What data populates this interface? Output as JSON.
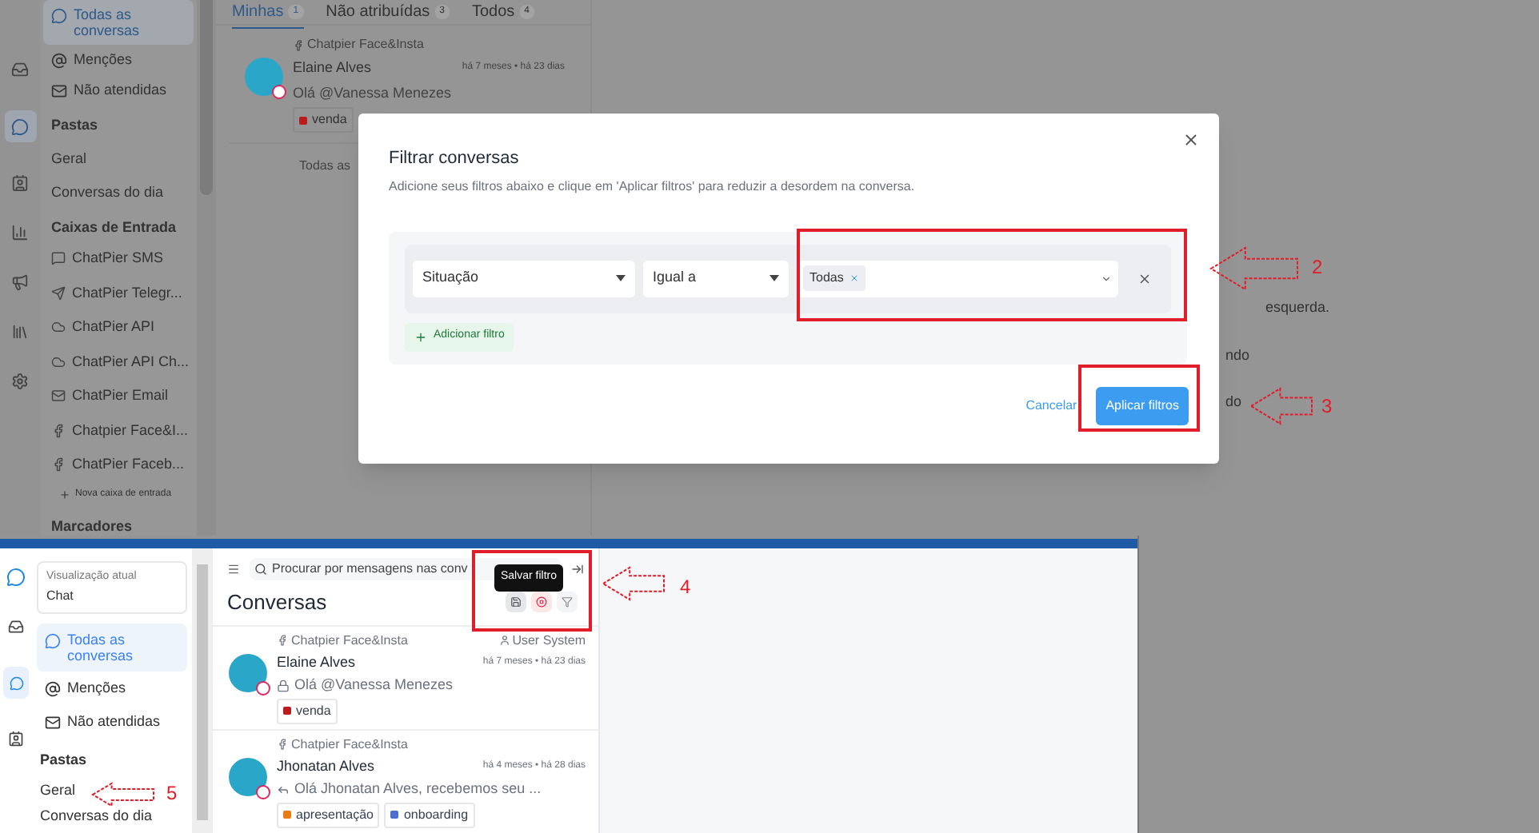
{
  "top_screen": {
    "sidebar": {
      "views": [
        {
          "label": "Todas as conversas",
          "kind": "all",
          "selected": true
        },
        {
          "label": "Menções",
          "kind": "mention",
          "selected": false
        },
        {
          "label": "Não atendidas",
          "kind": "unattended",
          "selected": false
        }
      ],
      "folders_heading": "Pastas",
      "folders": [
        "Geral",
        "Conversas do dia"
      ],
      "inboxes_heading": "Caixas de Entrada",
      "inboxes": [
        {
          "label": "ChatPier SMS",
          "kind": "sms"
        },
        {
          "label": "ChatPier Telegr...",
          "kind": "telegram"
        },
        {
          "label": "ChatPier API",
          "kind": "api"
        },
        {
          "label": "ChatPier API Ch...",
          "kind": "api"
        },
        {
          "label": "ChatPier Email",
          "kind": "email"
        },
        {
          "label": "Chatpier Face&I...",
          "kind": "facebook"
        },
        {
          "label": "ChatPier Faceb...",
          "kind": "facebook"
        }
      ],
      "new_inbox": "Nova caixa de entrada",
      "labels_heading": "Marcadores"
    },
    "tabs": [
      {
        "label": "Minhas",
        "count": "1",
        "selected": true
      },
      {
        "label": "Não atribuídas",
        "count": "3",
        "selected": false
      },
      {
        "label": "Todos",
        "count": "4",
        "selected": false
      }
    ],
    "conversations": [
      {
        "inbox": "Chatpier Face&Insta",
        "name": "Elaine Alves",
        "time": "há 7 meses • há 23 dias",
        "message": "Olá @Vanessa Menezes",
        "tags": [
          {
            "label": "venda",
            "color": "#b91c1c"
          }
        ]
      }
    ],
    "list_footer": "Todas as",
    "background_texts": [
      "esquerda.",
      "ndo",
      "do"
    ]
  },
  "filter_dialog": {
    "title": "Filtrar conversas",
    "description": "Adicione seus filtros abaixo e clique em 'Aplicar filtros' para reduzir a desordem na conversa.",
    "filters": [
      {
        "attribute": "Situação",
        "operator": "Igual a",
        "values": [
          "Todas"
        ]
      }
    ],
    "add_filter": "Adicionar filtro",
    "cancel": "Cancelar",
    "apply": "Aplicar filtros"
  },
  "bottom_screen": {
    "current_view_label": "Visualização atual",
    "current_view": "Chat",
    "views": [
      {
        "label": "Todas as conversas",
        "kind": "all",
        "selected": true
      },
      {
        "label": "Menções",
        "kind": "mention",
        "selected": false
      },
      {
        "label": "Não atendidas",
        "kind": "unattended",
        "selected": false
      }
    ],
    "folders_heading": "Pastas",
    "folders": [
      "Geral",
      "Conversas do dia"
    ],
    "search_placeholder": "Procurar por mensagens nas conv",
    "heading": "Conversas",
    "tooltip": "Salvar filtro",
    "conversations": [
      {
        "inbox": "Chatpier Face&Insta",
        "assignee": "User System",
        "name": "Elaine Alves",
        "time": "há 7 meses • há 23 dias",
        "kind": "locked",
        "message": "Olá @Vanessa Menezes",
        "tags": [
          {
            "label": "venda",
            "color": "#b91c1c"
          }
        ]
      },
      {
        "inbox": "Chatpier Face&Insta",
        "name": "Jhonatan Alves",
        "time": "há 4 meses • há 28 dias",
        "kind": "reply",
        "message": "Olá Jhonatan Alves, recebemos seu ...",
        "tags": [
          {
            "label": "apresentação",
            "color": "#ea7a12"
          },
          {
            "label": "onboarding",
            "color": "#4a6fd1"
          }
        ]
      }
    ]
  },
  "annotations": [
    {
      "label": "2"
    },
    {
      "label": "3"
    },
    {
      "label": "4"
    },
    {
      "label": "5"
    }
  ]
}
